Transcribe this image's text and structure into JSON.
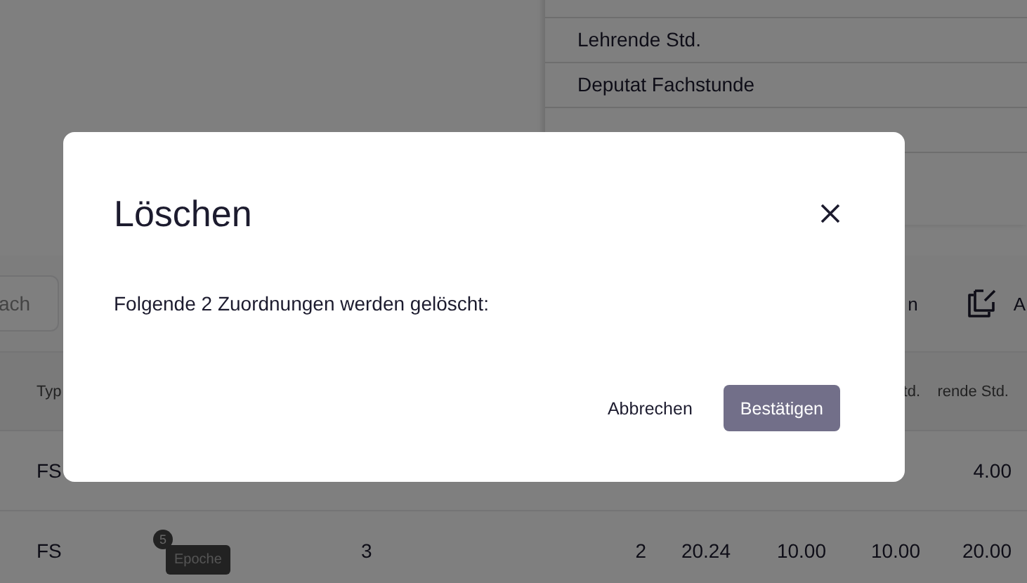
{
  "menu": {
    "items": [
      "Lehrende Std.",
      "Deputat Fachstunde"
    ]
  },
  "toolbar": {
    "search": {
      "placeholder": "ach"
    },
    "button_1": {
      "label": "n"
    },
    "button_2": {
      "label": "A"
    }
  },
  "table": {
    "header": {
      "column_1": "Typ",
      "column_7": "td.",
      "column_8": "rende Std."
    },
    "rows": [
      {
        "column_1": "FS",
        "column_8": "4.00"
      },
      {
        "column_1": "FS",
        "column_2": {
          "badge": "Epoche",
          "count": "5"
        },
        "column_3": "3",
        "column_4": "2",
        "column_5": "20.24",
        "column_6": "10.00",
        "column_7": "10.00",
        "column_8": "20.00"
      }
    ]
  },
  "dialog": {
    "title": "Löschen",
    "message": "Folgende 2 Zuordnungen werden gelöscht:",
    "buttons": [
      {
        "label": "Abbrechen",
        "kind": "text"
      },
      {
        "label": "Bestätigen",
        "kind": "primary"
      }
    ]
  }
}
